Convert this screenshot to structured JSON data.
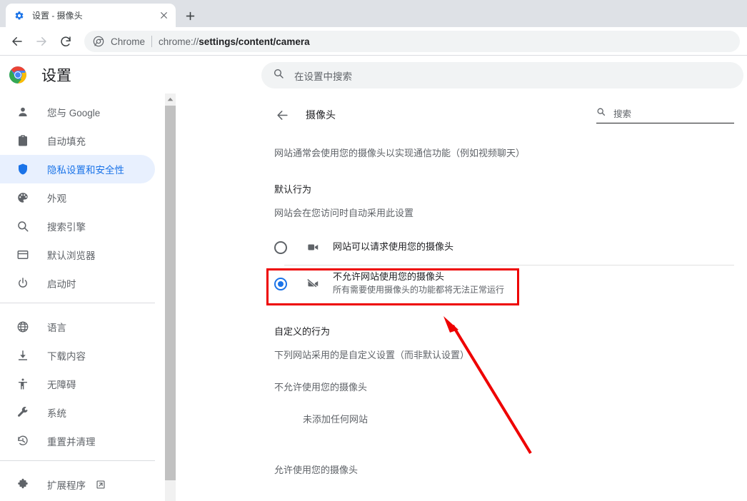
{
  "browser": {
    "tab": {
      "title": "设置 - 摄像头",
      "favicon_icon": "gear-icon",
      "close_icon": "close-icon"
    },
    "new_tab_label": "+",
    "toolbar": {
      "back_icon": "back-arrow-icon",
      "forward_icon": "forward-arrow-icon",
      "reload_icon": "reload-icon",
      "omnibox": {
        "site_icon": "chrome-logo-icon",
        "site_label": "Chrome",
        "url_prefix": "chrome://",
        "url_bold": "settings/content/camera"
      }
    }
  },
  "settings_header": {
    "logo_icon": "chrome-logo-icon",
    "title": "设置",
    "search": {
      "icon": "search-icon",
      "placeholder": "在设置中搜索"
    }
  },
  "sidebar": {
    "group1": [
      {
        "label": "您与 Google",
        "icon": "person-icon",
        "active": false
      },
      {
        "label": "自动填充",
        "icon": "clipboard-icon",
        "active": false
      },
      {
        "label": "隐私设置和安全性",
        "icon": "shield-icon",
        "active": true
      },
      {
        "label": "外观",
        "icon": "palette-icon",
        "active": false
      },
      {
        "label": "搜索引擎",
        "icon": "search-icon",
        "active": false
      },
      {
        "label": "默认浏览器",
        "icon": "browser-window-icon",
        "active": false
      },
      {
        "label": "启动时",
        "icon": "power-icon",
        "active": false
      }
    ],
    "group2": [
      {
        "label": "语言",
        "icon": "globe-icon"
      },
      {
        "label": "下载内容",
        "icon": "download-icon"
      },
      {
        "label": "无障碍",
        "icon": "accessibility-icon"
      },
      {
        "label": "系统",
        "icon": "wrench-icon"
      },
      {
        "label": "重置并清理",
        "icon": "history-restore-icon"
      }
    ],
    "group3": [
      {
        "label": "扩展程序",
        "icon": "puzzle-icon",
        "external_icon": "external-link-icon"
      }
    ],
    "scrollbar": {
      "up_icon": "scroll-up-arrow-icon"
    }
  },
  "main": {
    "back_icon": "back-arrow-icon",
    "title": "摄像头",
    "search": {
      "icon": "search-icon",
      "placeholder": "搜索"
    },
    "description": "网站通常会使用您的摄像头以实现通信功能（例如视频聊天）",
    "default_behavior": {
      "title": "默认行为",
      "subtitle": "网站会在您访问时自动采用此设置",
      "options": [
        {
          "label": "网站可以请求使用您的摄像头",
          "sublabel": "",
          "icon": "videocam-icon",
          "selected": false
        },
        {
          "label": "不允许网站使用您的摄像头",
          "sublabel": "所有需要使用摄像头的功能都将无法正常运行",
          "icon": "videocam-off-icon",
          "selected": true
        }
      ]
    },
    "custom_behavior": {
      "title": "自定义的行为",
      "subtitle": "下列网站采用的是自定义设置（而非默认设置）",
      "blocked_title": "不允许使用您的摄像头",
      "blocked_empty": "未添加任何网站",
      "allowed_title": "允许使用您的摄像头"
    }
  },
  "annotations": {
    "highlight_color": "#ee0000",
    "arrow_color": "#ee0000"
  },
  "colors": {
    "accent": "#1a73e8",
    "active_bg": "#e8f0fe",
    "text_primary": "#202124",
    "text_secondary": "#5f6368",
    "tabstrip_bg": "#dee1e6"
  }
}
